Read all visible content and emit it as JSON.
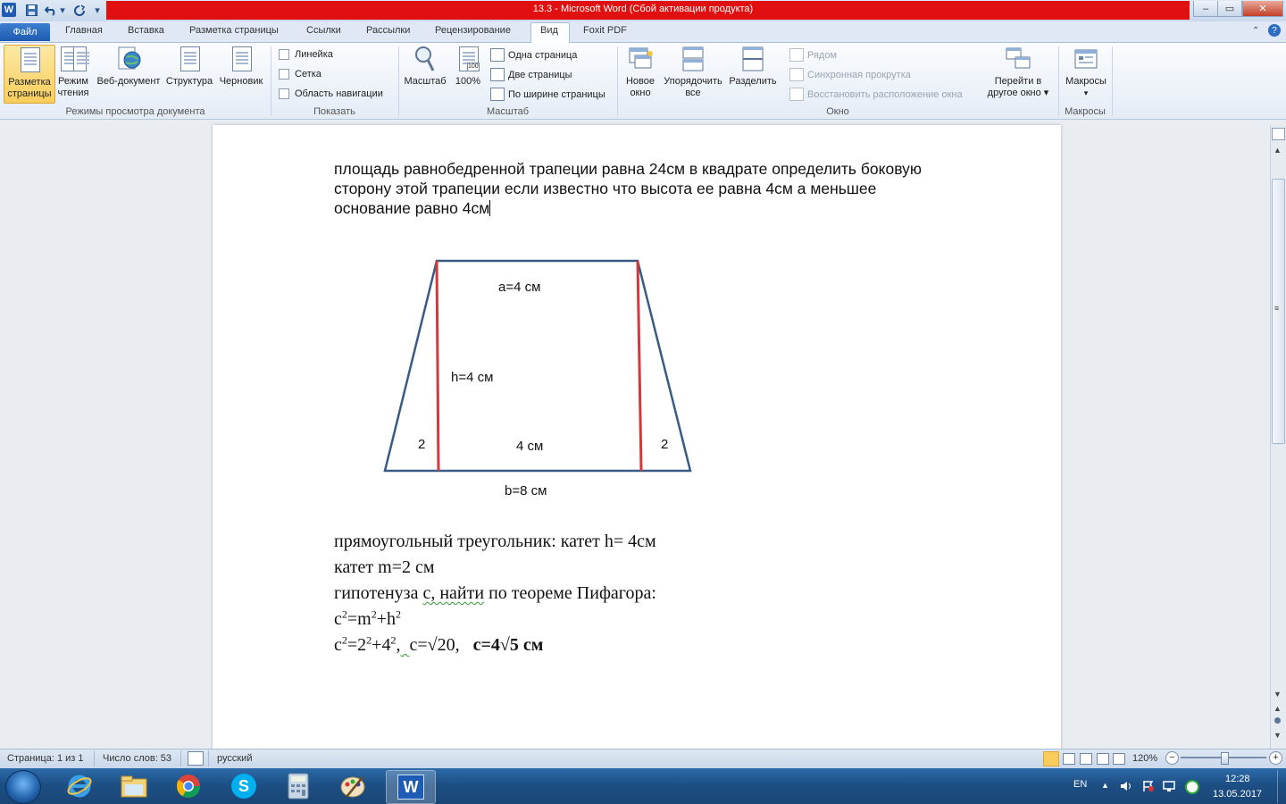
{
  "window": {
    "title": "13.3  -  Microsoft Word (Сбой активации продукта)",
    "word_logo": "W",
    "controls": {
      "minimize": "–",
      "maximize": "▭",
      "close": "✕"
    }
  },
  "quick_access": {
    "save_icon": "floppy-icon",
    "undo_icon": "undo-icon",
    "redo_icon": "redo-icon"
  },
  "tabs": {
    "file": "Файл",
    "items": [
      "Главная",
      "Вставка",
      "Разметка страницы",
      "Ссылки",
      "Рассылки",
      "Рецензирование",
      "Вид",
      "Foxit PDF"
    ],
    "active": "Вид"
  },
  "ribbon": {
    "views": {
      "layout": [
        "Разметка",
        "страницы"
      ],
      "reading": [
        "Режим",
        "чтения"
      ],
      "web": "Веб-документ",
      "structure": "Структура",
      "draft": "Черновик",
      "group": "Режимы просмотра документа"
    },
    "show": {
      "ruler": "Линейка",
      "grid": "Сетка",
      "navigation": "Область навигации",
      "group": "Показать"
    },
    "zoom": {
      "zoom": "Масштаб",
      "percent": "100%",
      "percent_badge": "100",
      "one_page": "Одна страница",
      "two_pages": "Две страницы",
      "page_width": "По ширине страницы",
      "group": "Масштаб"
    },
    "window": {
      "new_window": [
        "Новое",
        "окно"
      ],
      "arrange_all": [
        "Упорядочить",
        "все"
      ],
      "split": "Разделить",
      "side_by_side": "Рядом",
      "sync_scroll": "Синхронная прокрутка",
      "reset_position": "Восстановить расположение окна",
      "switch_windows": [
        "Перейти в",
        "другое окно ▾"
      ],
      "group": "Окно"
    },
    "macros": {
      "macros": "Макросы",
      "dropdown": "▾",
      "group": "Макросы"
    }
  },
  "document": {
    "problem": [
      "площадь равнобедренной трапеции равна 24см в квадрате определить боковую",
      "сторону этой трапеции если известно что высота ее равна 4см а меньшее",
      "основание равно 4см"
    ],
    "figure": {
      "top_label": "a=4 см",
      "height_label": "h=4 см",
      "left_seg": "2",
      "mid_seg": "4 см",
      "right_seg": "2",
      "bottom_label": "b=8 см"
    },
    "solution": {
      "line1": "прямоугольный треугольник: катет h= 4см",
      "line2": "катет m=2  см",
      "line3_pre": "гипотенуза ",
      "line3_c": "с, найти",
      "line3_post": " по теореме Пифагора:",
      "line4": {
        "c": "c",
        "two1": "2",
        "eq": "=m",
        "two2": "2",
        "plus": "+h",
        "two3": "2"
      },
      "line5": {
        "c": "c",
        "two1": "2",
        "eq": "=2",
        "two2": "2",
        "plus": "+4",
        "two3": "2",
        "comma": ",",
        "space": "  ",
        "c2": "c",
        "rest": "=√20,   ",
        "answer": "c=4√5 см"
      }
    }
  },
  "scrollbar": {
    "up": "▲",
    "down": "▼",
    "prev": "▲",
    "next": "▼",
    "grip": "≡",
    "ruler_icon": "ruler-toggle-icon"
  },
  "status": {
    "page": "Страница: 1 из 1",
    "words": "Число слов: 53",
    "language": "русский",
    "zoom": "120%",
    "zoom_level_percent": 120,
    "minus": "−",
    "plus": "+"
  },
  "taskbar": {
    "lang": "EN",
    "time": "12:28",
    "date": "13.05.2017",
    "apps": [
      "start-orb-icon",
      "internet-explorer-icon",
      "file-explorer-icon",
      "chrome-icon",
      "skype-icon",
      "calculator-icon",
      "paint-icon",
      "word-icon"
    ],
    "skype_letter": "S",
    "word_letter": "W"
  },
  "colors": {
    "accent": "#1d5ab0",
    "title_red": "#e01010",
    "figure_outline": "#3a5a86",
    "height_lines": "#d03a3a",
    "spelling": "#2f9b2f"
  }
}
